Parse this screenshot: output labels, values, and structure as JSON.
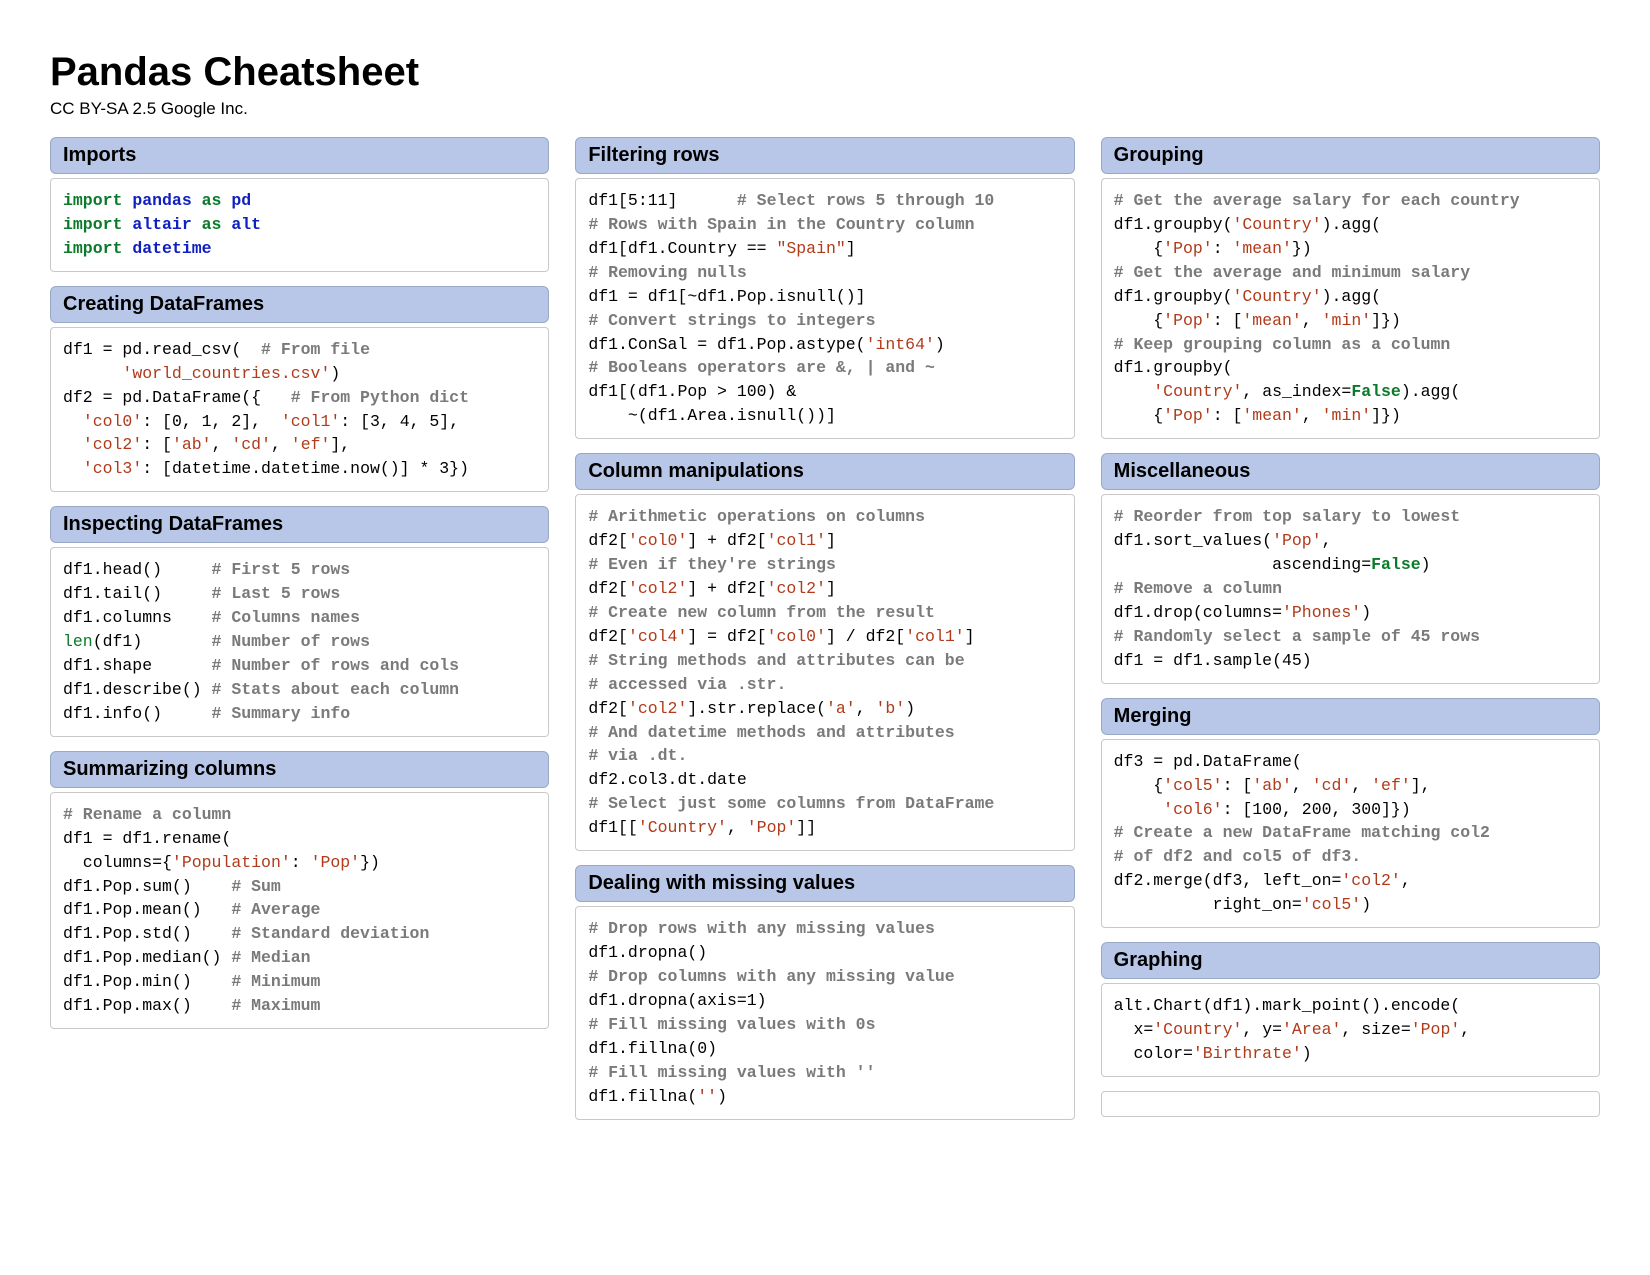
{
  "header": {
    "title": "Pandas Cheatsheet",
    "subtitle": "CC BY-SA 2.5 Google Inc."
  },
  "columns": [
    {
      "sections": [
        {
          "title": "Imports",
          "code": "<span class=\"kw\">import</span> <span class=\"mod\">pandas</span> <span class=\"kw\">as</span> <span class=\"mod\">pd</span>\n<span class=\"kw\">import</span> <span class=\"mod\">altair</span> <span class=\"kw\">as</span> <span class=\"mod\">alt</span>\n<span class=\"kw\">import</span> <span class=\"mod\">datetime</span>"
        },
        {
          "title": "Creating DataFrames",
          "code": "df1 = pd.read_csv(  <span class=\"com\"># From file</span>\n      <span class=\"str\">'world_countries.csv'</span>)\ndf2 = pd.DataFrame({   <span class=\"com\"># From Python dict</span>\n  <span class=\"str\">'col0'</span>: [0, 1, 2],  <span class=\"str\">'col1'</span>: [3, 4, 5],\n  <span class=\"str\">'col2'</span>: [<span class=\"str\">'ab'</span>, <span class=\"str\">'cd'</span>, <span class=\"str\">'ef'</span>],\n  <span class=\"str\">'col3'</span>: [datetime.datetime.now()] * 3})"
        },
        {
          "title": "Inspecting DataFrames",
          "code": "df1.head()     <span class=\"com\"># First 5 rows</span>\ndf1.tail()     <span class=\"com\"># Last 5 rows</span>\ndf1.columns    <span class=\"com\"># Columns names</span>\n<span class=\"fn\">len</span>(df1)       <span class=\"com\"># Number of rows</span>\ndf1.shape      <span class=\"com\"># Number of rows and cols</span>\ndf1.describe() <span class=\"com\"># Stats about each column</span>\ndf1.info()     <span class=\"com\"># Summary info</span>"
        },
        {
          "title": "Summarizing columns",
          "code": "<span class=\"com\"># Rename a column</span>\ndf1 = df1.rename(\n  columns={<span class=\"str\">'Population'</span>: <span class=\"str\">'Pop'</span>})\ndf1.Pop.sum()    <span class=\"com\"># Sum</span>\ndf1.Pop.mean()   <span class=\"com\"># Average</span>\ndf1.Pop.std()    <span class=\"com\"># Standard deviation</span>\ndf1.Pop.median() <span class=\"com\"># Median</span>\ndf1.Pop.min()    <span class=\"com\"># Minimum</span>\ndf1.Pop.max()    <span class=\"com\"># Maximum</span>"
        }
      ]
    },
    {
      "sections": [
        {
          "title": "Filtering rows",
          "code": "df1[5:11]      <span class=\"com\"># Select rows 5 through 10</span>\n<span class=\"com\"># Rows with Spain in the Country column</span>\ndf1[df1.Country == <span class=\"str\">\"Spain\"</span>]\n<span class=\"com\"># Removing nulls</span>\ndf1 = df1[~df1.Pop.isnull()]\n<span class=\"com\"># Convert strings to integers</span>\ndf1.ConSal = df1.Pop.astype(<span class=\"str\">'int64'</span>)\n<span class=\"com\"># Booleans operators are &amp;, | and ~</span>\ndf1[(df1.Pop &gt; 100) &amp;\n    ~(df1.Area.isnull())]"
        },
        {
          "title": "Column manipulations",
          "code": "<span class=\"com\"># Arithmetic operations on columns</span>\ndf2[<span class=\"str\">'col0'</span>] + df2[<span class=\"str\">'col1'</span>]\n<span class=\"com\"># Even if they're strings</span>\ndf2[<span class=\"str\">'col2'</span>] + df2[<span class=\"str\">'col2'</span>]\n<span class=\"com\"># Create new column from the result</span>\ndf2[<span class=\"str\">'col4'</span>] = df2[<span class=\"str\">'col0'</span>] / df2[<span class=\"str\">'col1'</span>]\n<span class=\"com\"># String methods and attributes can be</span>\n<span class=\"com\"># accessed via .str.</span>\ndf2[<span class=\"str\">'col2'</span>].str.replace(<span class=\"str\">'a'</span>, <span class=\"str\">'b'</span>)\n<span class=\"com\"># And datetime methods and attributes</span>\n<span class=\"com\"># via .dt.</span>\ndf2.col3.dt.date\n<span class=\"com\"># Select just some columns from DataFrame</span>\ndf1[[<span class=\"str\">'Country'</span>, <span class=\"str\">'Pop'</span>]]"
        },
        {
          "title": "Dealing with missing values",
          "code": "<span class=\"com\"># Drop rows with any missing values</span>\ndf1.dropna()\n<span class=\"com\"># Drop columns with any missing value</span>\ndf1.dropna(axis=1)\n<span class=\"com\"># Fill missing values with 0s</span>\ndf1.fillna(0)\n<span class=\"com\"># Fill missing values with ''</span>\ndf1.fillna(<span class=\"str\">''</span>)"
        }
      ]
    },
    {
      "sections": [
        {
          "title": "Grouping",
          "code": "<span class=\"com\"># Get the average salary for each country</span>\ndf1.groupby(<span class=\"str\">'Country'</span>).agg(\n    {<span class=\"str\">'Pop'</span>: <span class=\"str\">'mean'</span>})\n<span class=\"com\"># Get the average and minimum salary</span>\ndf1.groupby(<span class=\"str\">'Country'</span>).agg(\n    {<span class=\"str\">'Pop'</span>: [<span class=\"str\">'mean'</span>, <span class=\"str\">'min'</span>]})\n<span class=\"com\"># Keep grouping column as a column</span>\ndf1.groupby(\n    <span class=\"str\">'Country'</span>, as_index=<span class=\"lit\">False</span>).agg(\n    {<span class=\"str\">'Pop'</span>: [<span class=\"str\">'mean'</span>, <span class=\"str\">'min'</span>]})"
        },
        {
          "title": "Miscellaneous",
          "code": "<span class=\"com\"># Reorder from top salary to lowest</span>\ndf1.sort_values(<span class=\"str\">'Pop'</span>,\n                ascending=<span class=\"lit\">False</span>)\n<span class=\"com\"># Remove a column</span>\ndf1.drop(columns=<span class=\"str\">'Phones'</span>)\n<span class=\"com\"># Randomly select a sample of 45 rows</span>\ndf1 = df1.sample(45)"
        },
        {
          "title": "Merging",
          "code": "df3 = pd.DataFrame(\n    {<span class=\"str\">'col5'</span>: [<span class=\"str\">'ab'</span>, <span class=\"str\">'cd'</span>, <span class=\"str\">'ef'</span>],\n     <span class=\"str\">'col6'</span>: [100, 200, 300]})\n<span class=\"com\"># Create a new DataFrame matching col2</span>\n<span class=\"com\"># of df2 and col5 of df3.</span>\ndf2.merge(df3, left_on=<span class=\"str\">'col2'</span>,\n          right_on=<span class=\"str\">'col5'</span>)"
        },
        {
          "title": "Graphing",
          "code": "alt.Chart(df1).mark_point().encode(\n  x=<span class=\"str\">'Country'</span>, y=<span class=\"str\">'Area'</span>, size=<span class=\"str\">'Pop'</span>,\n  color=<span class=\"str\">'Birthrate'</span>)"
        },
        {
          "title": null,
          "code": ""
        }
      ]
    }
  ]
}
